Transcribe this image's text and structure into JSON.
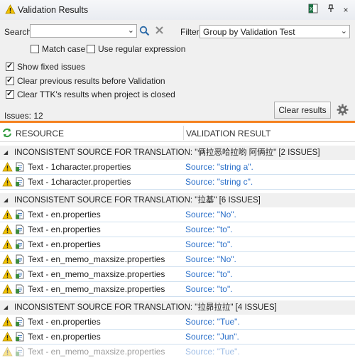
{
  "window": {
    "title": "Validation Results",
    "close_glyph": "×",
    "pin_glyph": "📌"
  },
  "search": {
    "label": "Search",
    "value": "",
    "placeholder": ""
  },
  "filter": {
    "label": "Filter",
    "selected": "Group by Validation Test"
  },
  "options": {
    "match_case": {
      "label": "Match case",
      "checked": false
    },
    "regex": {
      "label": "Use regular expression",
      "checked": false
    },
    "show_fixed": {
      "label": "Show fixed issues",
      "checked": true
    },
    "clear_previous": {
      "label": "Clear previous results before Validation",
      "checked": true
    },
    "clear_ttk": {
      "label": "Clear TTK's results when project is closed",
      "checked": true
    }
  },
  "issues_count": "Issues: 12",
  "clear_results_label": "Clear results",
  "columns": {
    "resource": "RESOURCE",
    "validation_result": "VALIDATION RESULT"
  },
  "groups": [
    {
      "title": "INCONSISTENT SOURCE FOR TRANSLATION: \"俩拉恶哈拉哟 阿俩拉\" [2 ISSUES]",
      "rows": [
        {
          "resource": "Text - 1character.properties",
          "result": "Source: \"string a\"."
        },
        {
          "resource": "Text - 1character.properties",
          "result": "Source: \"string c\"."
        }
      ]
    },
    {
      "title": "INCONSISTENT SOURCE FOR TRANSLATION: \"拉基\" [6 ISSUES]",
      "rows": [
        {
          "resource": "Text - en.properties",
          "result": "Source: \"No\"."
        },
        {
          "resource": "Text - en.properties",
          "result": "Source: \"to\"."
        },
        {
          "resource": "Text - en.properties",
          "result": "Source: \"to\"."
        },
        {
          "resource": "Text - en_memo_maxsize.properties",
          "result": "Source: \"No\"."
        },
        {
          "resource": "Text - en_memo_maxsize.properties",
          "result": "Source: \"to\"."
        },
        {
          "resource": "Text - en_memo_maxsize.properties",
          "result": "Source: \"to\"."
        }
      ]
    },
    {
      "title": "INCONSISTENT SOURCE FOR TRANSLATION: \"拉昴拉拉\" [4 ISSUES]",
      "rows": [
        {
          "resource": "Text - en.properties",
          "result": "Source: \"Tue\"."
        },
        {
          "resource": "Text - en.properties",
          "result": "Source: \"Jun\"."
        },
        {
          "resource": "Text - en_memo_maxsize.properties",
          "result": "Source: \"Tue\"."
        }
      ]
    }
  ],
  "colors": {
    "accent_orange": "#f58220",
    "link_blue": "#2a6fc9",
    "warning_yellow": "#f2c200"
  }
}
